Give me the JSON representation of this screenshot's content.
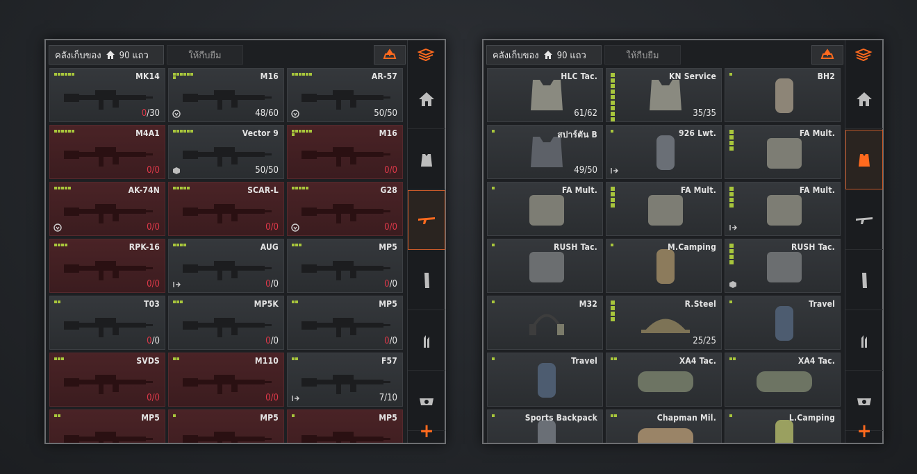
{
  "left": {
    "storage_label": "คลังเก็บของ",
    "capacity_label": "90 แถว",
    "rent_label": "ให้กืบยืม",
    "items": [
      {
        "name": "MK14",
        "ammo_cur": "0",
        "ammo_max": "/30",
        "empty": false,
        "pips": 6,
        "badge": ""
      },
      {
        "name": "M16",
        "ammo_cur": "48",
        "ammo_max": "/60",
        "empty": false,
        "pips": 7,
        "badge": "shield"
      },
      {
        "name": "AR-57",
        "ammo_cur": "50",
        "ammo_max": "/50",
        "empty": false,
        "pips": 6,
        "badge": "shield"
      },
      {
        "name": "M4A1",
        "ammo_cur": "0",
        "ammo_max": "/0",
        "empty": true,
        "pips": 6,
        "badge": ""
      },
      {
        "name": "Vector 9",
        "ammo_cur": "50",
        "ammo_max": "/50",
        "empty": false,
        "pips": 6,
        "badge": "cube"
      },
      {
        "name": "M16",
        "ammo_cur": "0",
        "ammo_max": "/0",
        "empty": true,
        "pips": 7,
        "badge": ""
      },
      {
        "name": "AK-74N",
        "ammo_cur": "0",
        "ammo_max": "/0",
        "empty": true,
        "pips": 5,
        "badge": "shield"
      },
      {
        "name": "SCAR-L",
        "ammo_cur": "0",
        "ammo_max": "/0",
        "empty": true,
        "pips": 5,
        "badge": ""
      },
      {
        "name": "G28",
        "ammo_cur": "0",
        "ammo_max": "/0",
        "empty": true,
        "pips": 5,
        "badge": "shield"
      },
      {
        "name": "RPK-16",
        "ammo_cur": "0",
        "ammo_max": "/0",
        "empty": true,
        "pips": 4,
        "badge": ""
      },
      {
        "name": "AUG",
        "ammo_cur": "0",
        "ammo_max": "/0",
        "empty": false,
        "pips": 4,
        "badge": "exit"
      },
      {
        "name": "MP5",
        "ammo_cur": "0",
        "ammo_max": "/0",
        "empty": false,
        "pips": 3,
        "badge": ""
      },
      {
        "name": "T03",
        "ammo_cur": "0",
        "ammo_max": "/0",
        "empty": false,
        "pips": 2,
        "badge": ""
      },
      {
        "name": "MP5K",
        "ammo_cur": "0",
        "ammo_max": "/0",
        "empty": false,
        "pips": 3,
        "badge": ""
      },
      {
        "name": "MP5",
        "ammo_cur": "0",
        "ammo_max": "/0",
        "empty": false,
        "pips": 2,
        "badge": ""
      },
      {
        "name": "SVDS",
        "ammo_cur": "0",
        "ammo_max": "/0",
        "empty": true,
        "pips": 3,
        "badge": ""
      },
      {
        "name": "M110",
        "ammo_cur": "0",
        "ammo_max": "/0",
        "empty": true,
        "pips": 2,
        "badge": ""
      },
      {
        "name": "F57",
        "ammo_cur": "7",
        "ammo_max": "/10",
        "empty": false,
        "pips": 2,
        "badge": "exit"
      },
      {
        "name": "MP5",
        "ammo_cur": "",
        "ammo_max": "",
        "empty": true,
        "pips": 2,
        "badge": ""
      },
      {
        "name": "MP5",
        "ammo_cur": "",
        "ammo_max": "",
        "empty": true,
        "pips": 1,
        "badge": ""
      },
      {
        "name": "MP5",
        "ammo_cur": "",
        "ammo_max": "",
        "empty": true,
        "pips": 1,
        "badge": ""
      }
    ]
  },
  "right": {
    "storage_label": "คลังเก็บของ",
    "capacity_label": "90 แถว",
    "rent_label": "ให้กืบยืม",
    "items": [
      {
        "name": "HLC Tac.",
        "durability": "61/62",
        "pips": 0,
        "badge": "",
        "art": "vest"
      },
      {
        "name": "KN Service",
        "durability": "35/35",
        "pips": 9,
        "badge": "",
        "art": "vest"
      },
      {
        "name": "BH2",
        "durability": "",
        "pips": 1,
        "badge": "",
        "art": "bag"
      },
      {
        "name": "สปาร์ตัน B",
        "durability": "49/50",
        "pips": 1,
        "badge": "",
        "art": "vest-dark"
      },
      {
        "name": "926 Lwt.",
        "durability": "",
        "pips": 1,
        "badge": "exit",
        "art": "bag-dark"
      },
      {
        "name": "FA Mult.",
        "durability": "",
        "pips": 4,
        "badge": "",
        "art": "pouch"
      },
      {
        "name": "FA Mult.",
        "durability": "",
        "pips": 1,
        "badge": "",
        "art": "pouch"
      },
      {
        "name": "FA Mult.",
        "durability": "",
        "pips": 4,
        "badge": "",
        "art": "pouch"
      },
      {
        "name": "FA Mult.",
        "durability": "",
        "pips": 4,
        "badge": "exit",
        "art": "pouch"
      },
      {
        "name": "RUSH Tac.",
        "durability": "",
        "pips": 1,
        "badge": "",
        "art": "pack"
      },
      {
        "name": "M.Camping",
        "durability": "",
        "pips": 1,
        "badge": "",
        "art": "bag-tan"
      },
      {
        "name": "RUSH Tac.",
        "durability": "",
        "pips": 4,
        "badge": "cube",
        "art": "pack"
      },
      {
        "name": "M32",
        "durability": "",
        "pips": 1,
        "badge": "",
        "art": "headset"
      },
      {
        "name": "R.Steel",
        "durability": "25/25",
        "pips": 4,
        "badge": "",
        "art": "helmet"
      },
      {
        "name": "Travel",
        "durability": "",
        "pips": 1,
        "badge": "",
        "art": "bag-blue"
      },
      {
        "name": "Travel",
        "durability": "",
        "pips": 1,
        "badge": "",
        "art": "bag-blue"
      },
      {
        "name": "XA4 Tac.",
        "durability": "",
        "pips": 2,
        "badge": "",
        "art": "duffel"
      },
      {
        "name": "XA4 Tac.",
        "durability": "",
        "pips": 2,
        "badge": "",
        "art": "duffel"
      },
      {
        "name": "Sports Backpack",
        "durability": "",
        "pips": 1,
        "badge": "",
        "art": "bag-dark"
      },
      {
        "name": "Chapman Mil.",
        "durability": "",
        "pips": 2,
        "badge": "",
        "art": "duffel-tan"
      },
      {
        "name": "L.Camping",
        "durability": "",
        "pips": 1,
        "badge": "",
        "art": "bag-green"
      }
    ]
  },
  "sidebar": {
    "left_active": 3,
    "right_active": 2,
    "icons": [
      "storage-swap-icon",
      "home-icon",
      "armor-icon",
      "gun-icon",
      "magazine-icon",
      "ammo-icon",
      "scope-icon"
    ],
    "plus_label": "+"
  },
  "colors": {
    "accent": "#ff6a1e",
    "pip": "#a8c63c",
    "empty_ammo": "#e0394a",
    "empty_cell": "#4a2326"
  }
}
